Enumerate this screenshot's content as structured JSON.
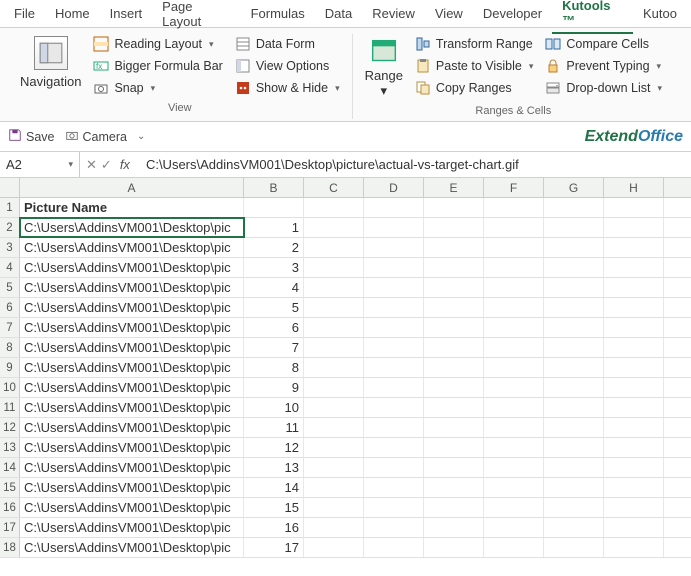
{
  "menu": [
    "File",
    "Home",
    "Insert",
    "Page Layout",
    "Formulas",
    "Data",
    "Review",
    "View",
    "Developer",
    "Kutools ™",
    "Kutoo"
  ],
  "active_menu": 9,
  "ribbon": {
    "nav": "Navigation",
    "view_group": "View",
    "reading": "Reading Layout",
    "bigger": "Bigger Formula Bar",
    "snap": "Snap",
    "dataform": "Data Form",
    "viewopt": "View Options",
    "showhide": "Show & Hide",
    "range": "Range",
    "transform": "Transform Range",
    "paste": "Paste to Visible",
    "copy": "Copy Ranges",
    "compare": "Compare Cells",
    "prevent": "Prevent Typing",
    "dropdown": "Drop-down List",
    "ranges_cells": "Ranges & Cells"
  },
  "qa": {
    "save": "Save",
    "camera": "Camera",
    "brand1": "Extend",
    "brand2": "Office"
  },
  "formula": {
    "name": "A2",
    "value": "C:\\Users\\AddinsVM001\\Desktop\\picture\\actual-vs-target-chart.gif"
  },
  "cols": [
    "A",
    "B",
    "C",
    "D",
    "E",
    "F",
    "G",
    "H"
  ],
  "header": "Picture Name",
  "rows": [
    {
      "n": 1,
      "a": "Picture Name",
      "b": ""
    },
    {
      "n": 2,
      "a": "C:\\Users\\AddinsVM001\\Desktop\\pic",
      "b": "1"
    },
    {
      "n": 3,
      "a": "C:\\Users\\AddinsVM001\\Desktop\\pic",
      "b": "2"
    },
    {
      "n": 4,
      "a": "C:\\Users\\AddinsVM001\\Desktop\\pic",
      "b": "3"
    },
    {
      "n": 5,
      "a": "C:\\Users\\AddinsVM001\\Desktop\\pic",
      "b": "4"
    },
    {
      "n": 6,
      "a": "C:\\Users\\AddinsVM001\\Desktop\\pic",
      "b": "5"
    },
    {
      "n": 7,
      "a": "C:\\Users\\AddinsVM001\\Desktop\\pic",
      "b": "6"
    },
    {
      "n": 8,
      "a": "C:\\Users\\AddinsVM001\\Desktop\\pic",
      "b": "7"
    },
    {
      "n": 9,
      "a": "C:\\Users\\AddinsVM001\\Desktop\\pic",
      "b": "8"
    },
    {
      "n": 10,
      "a": "C:\\Users\\AddinsVM001\\Desktop\\pic",
      "b": "9"
    },
    {
      "n": 11,
      "a": "C:\\Users\\AddinsVM001\\Desktop\\pic",
      "b": "10"
    },
    {
      "n": 12,
      "a": "C:\\Users\\AddinsVM001\\Desktop\\pic",
      "b": "11"
    },
    {
      "n": 13,
      "a": "C:\\Users\\AddinsVM001\\Desktop\\pic",
      "b": "12"
    },
    {
      "n": 14,
      "a": "C:\\Users\\AddinsVM001\\Desktop\\pic",
      "b": "13"
    },
    {
      "n": 15,
      "a": "C:\\Users\\AddinsVM001\\Desktop\\pic",
      "b": "14"
    },
    {
      "n": 16,
      "a": "C:\\Users\\AddinsVM001\\Desktop\\pic",
      "b": "15"
    },
    {
      "n": 17,
      "a": "C:\\Users\\AddinsVM001\\Desktop\\pic",
      "b": "16"
    },
    {
      "n": 18,
      "a": "C:\\Users\\AddinsVM001\\Desktop\\pic",
      "b": "17"
    }
  ]
}
